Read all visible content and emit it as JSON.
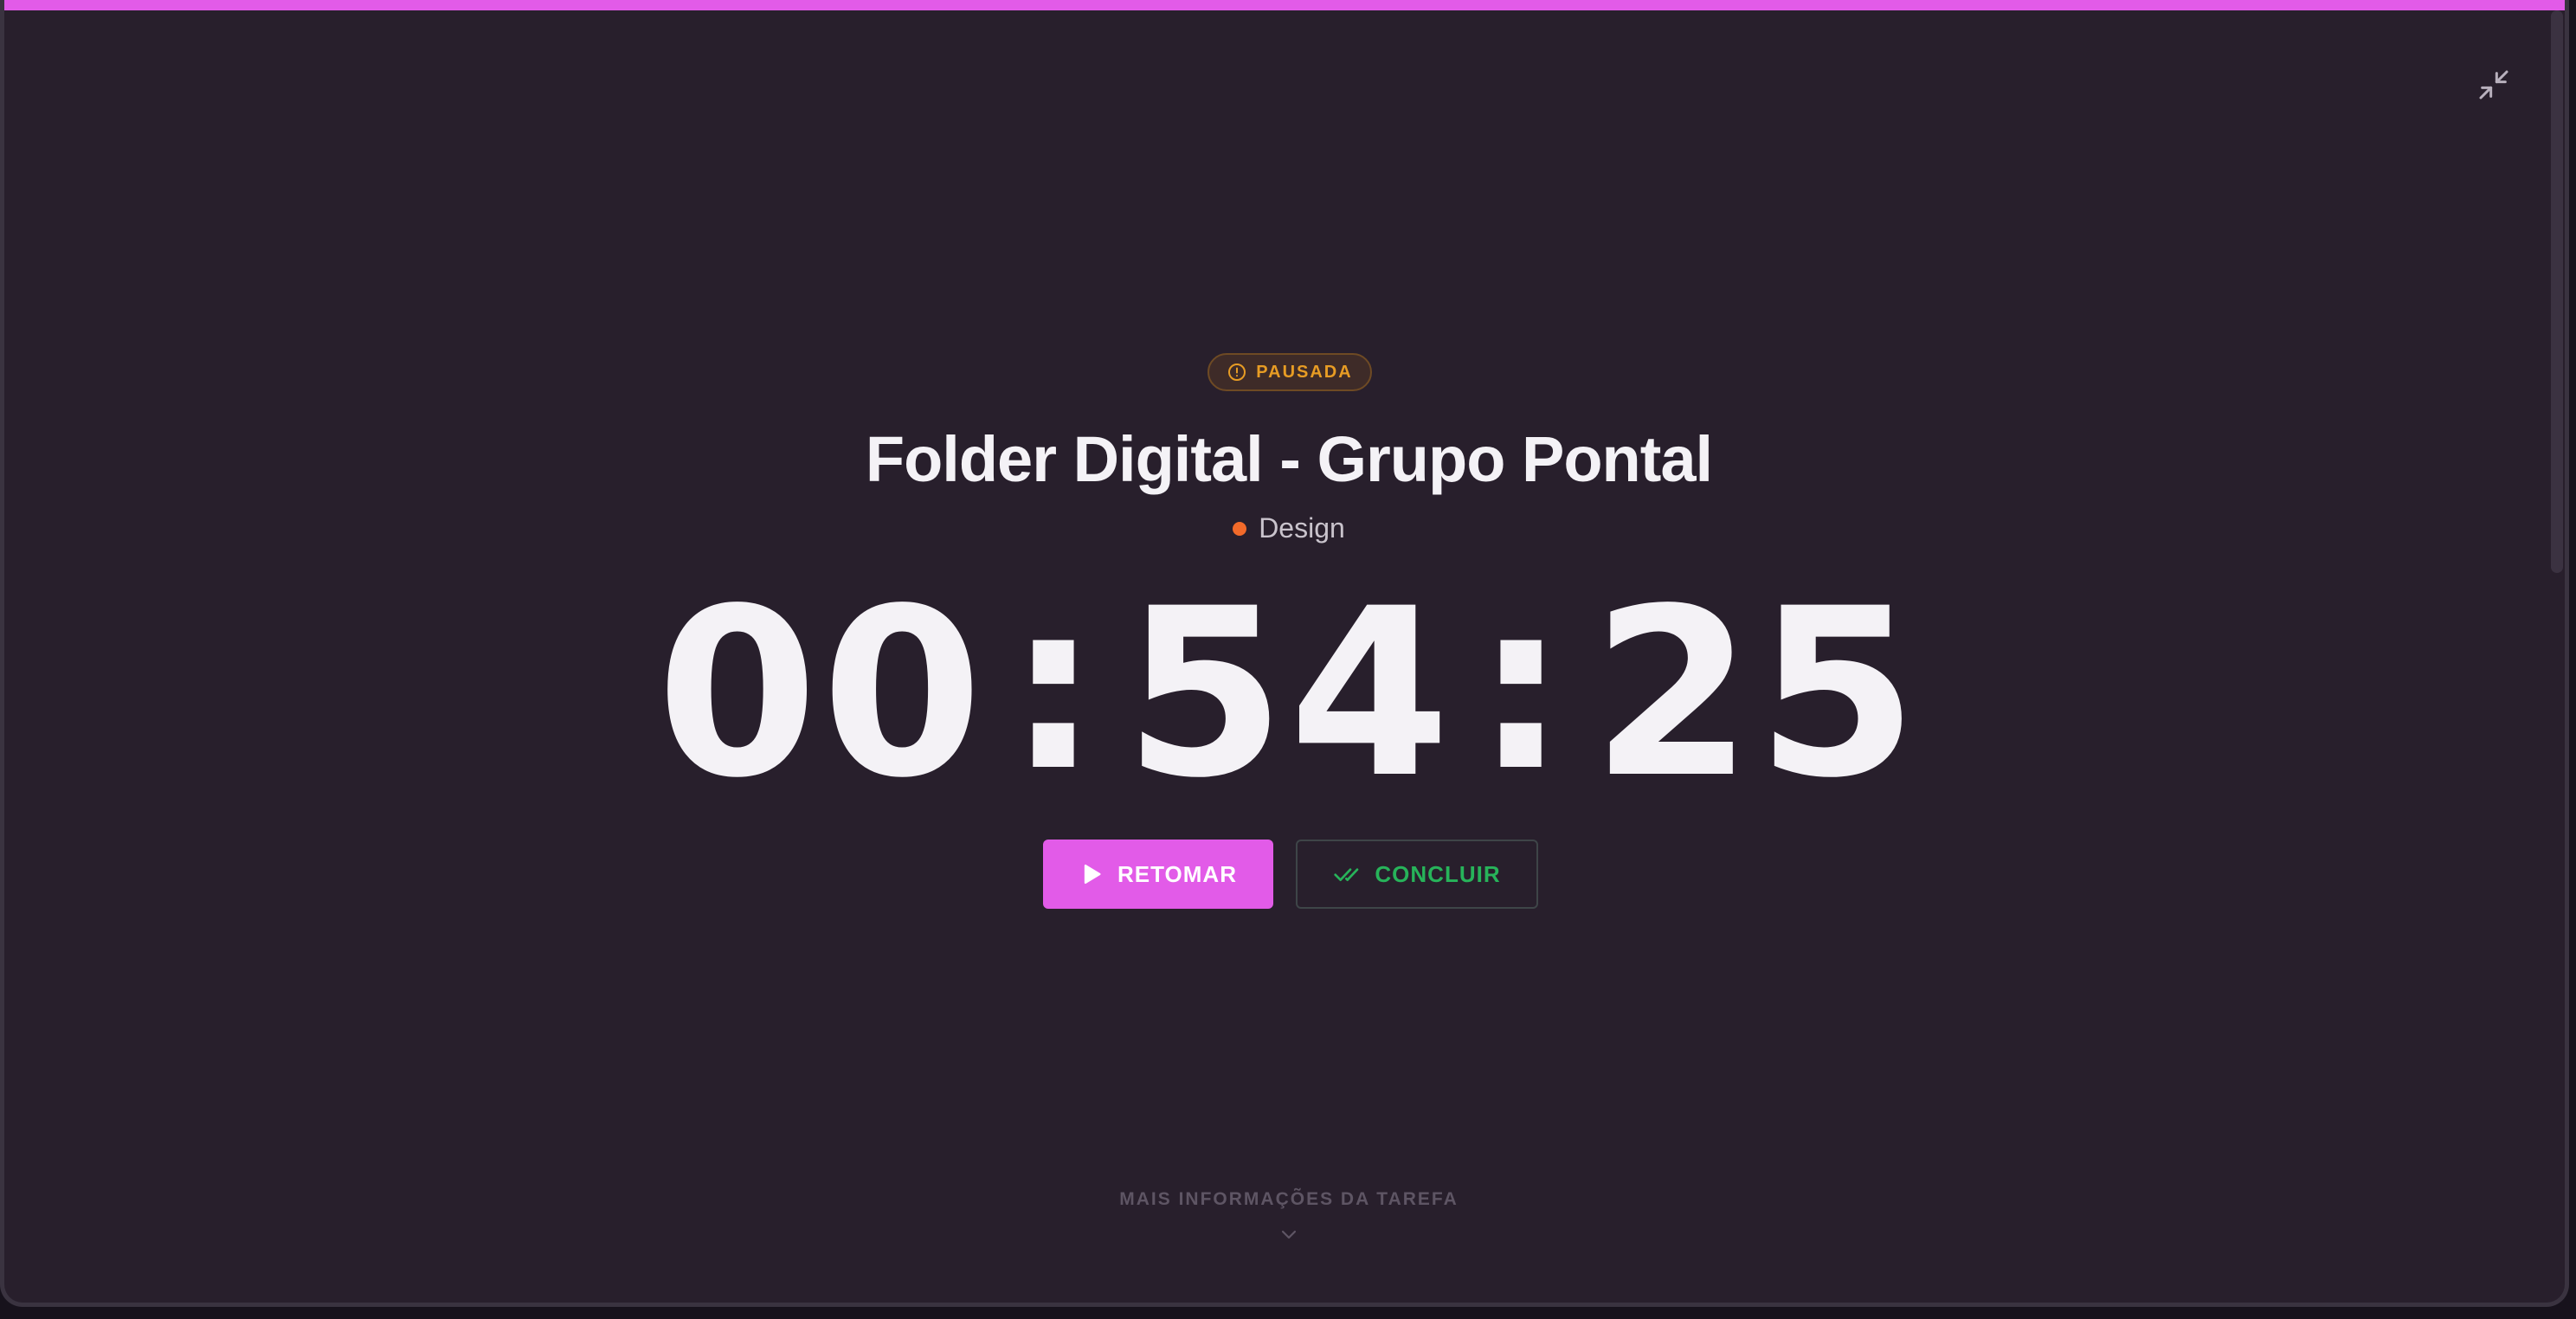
{
  "status": {
    "label": "PAUSADA",
    "icon": "alert-circle-icon",
    "color": "#e79c24"
  },
  "task": {
    "title": "Folder Digital - Grupo Pontal",
    "category": "Design",
    "category_color": "#f26a2a"
  },
  "timer": {
    "hours": "00",
    "minutes": "54",
    "seconds": "25",
    "separator": ":"
  },
  "actions": {
    "resume_label": "RETOMAR",
    "resume_icon": "play-icon",
    "complete_label": "CONCLUIR",
    "complete_icon": "double-check-icon"
  },
  "footer": {
    "more_info_label": "MAIS INFORMAÇÕES DA TAREFA",
    "more_info_icon": "chevron-down-icon"
  },
  "window": {
    "minimize_icon": "minimize-icon"
  },
  "colors": {
    "accent": "#e25be8",
    "background": "#281f2c",
    "success": "#27b35a"
  }
}
